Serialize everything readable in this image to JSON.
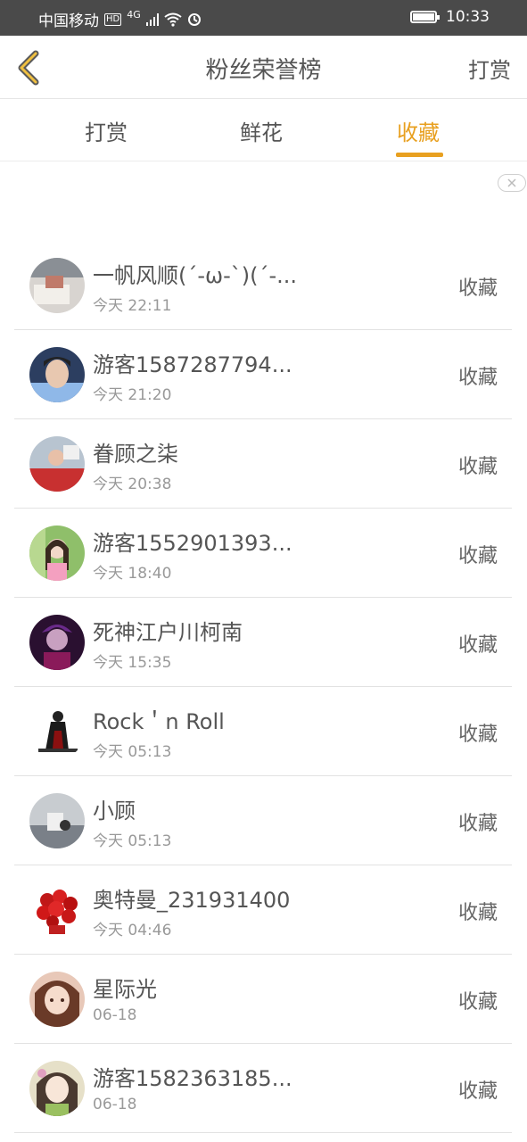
{
  "status_bar": {
    "carrier": "中国移动",
    "hd_badge": "HD",
    "network": "4G",
    "time": "10:33"
  },
  "header": {
    "title": "粉丝荣誉榜",
    "right_action": "打赏"
  },
  "tabs": [
    {
      "label": "打赏",
      "active": false
    },
    {
      "label": "鲜花",
      "active": false
    },
    {
      "label": "收藏",
      "active": true
    }
  ],
  "colors": {
    "accent": "#e8a020",
    "status_bar_bg": "#4a4a4a",
    "text_primary": "#555555",
    "text_secondary": "#999999"
  },
  "list": [
    {
      "name": "一帆风顺(´-ω-`)(´-...",
      "time": "今天 22:11",
      "action": "收藏",
      "avatar": "photo-room"
    },
    {
      "name": "游客1587287794...",
      "time": "今天 21:20",
      "action": "收藏",
      "avatar": "photo-man"
    },
    {
      "name": "眷顾之柒",
      "time": "今天 20:38",
      "action": "收藏",
      "avatar": "photo-person-red"
    },
    {
      "name": "游客1552901393...",
      "time": "今天 18:40",
      "action": "收藏",
      "avatar": "photo-girl"
    },
    {
      "name": "死神江户川柯南",
      "time": "今天 15:35",
      "action": "收藏",
      "avatar": "anime-dark"
    },
    {
      "name": "Rock＇n Roll",
      "time": "今天 05:13",
      "action": "收藏",
      "avatar": "figure-black"
    },
    {
      "name": "小顾",
      "time": "今天 05:13",
      "action": "收藏",
      "avatar": "photo-scenery"
    },
    {
      "name": "奥特曼_231931400",
      "time": "今天 04:46",
      "action": "收藏",
      "avatar": "red-roses"
    },
    {
      "name": "星际光",
      "time": "06-18",
      "action": "收藏",
      "avatar": "anime-girl"
    },
    {
      "name": "游客1582363185...",
      "time": "06-18",
      "action": "收藏",
      "avatar": "anime-girl-2"
    }
  ]
}
